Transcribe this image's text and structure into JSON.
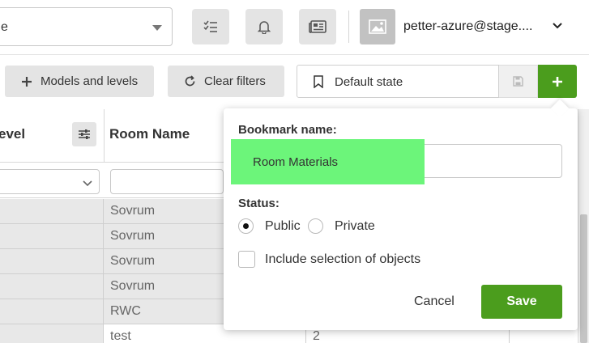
{
  "topbar": {
    "select_value": "e",
    "user_name": "petter-azure@stage...."
  },
  "toolbar": {
    "models_levels_label": "Models and levels",
    "clear_filters_label": "Clear filters",
    "bookmark_state_label": "Default state"
  },
  "table": {
    "col1_header": "evel",
    "col2_header": "Room Name",
    "rows": [
      {
        "room": "Sovrum",
        "value": ""
      },
      {
        "room": "Sovrum",
        "value": ""
      },
      {
        "room": "Sovrum",
        "value": ""
      },
      {
        "room": "Sovrum",
        "value": ""
      },
      {
        "room": "RWC",
        "value": ""
      },
      {
        "room": "test",
        "value": "2"
      }
    ]
  },
  "bookmark_popover": {
    "name_label": "Bookmark name:",
    "name_value": "Room Materials",
    "status_label": "Status:",
    "public_label": "Public",
    "private_label": "Private",
    "status_selected": "Public",
    "include_selection_label": "Include selection of objects",
    "include_selection_checked": false,
    "cancel_label": "Cancel",
    "save_label": "Save"
  },
  "colors": {
    "accent": "#4b9d1d",
    "highlight": "#6cf57a"
  }
}
